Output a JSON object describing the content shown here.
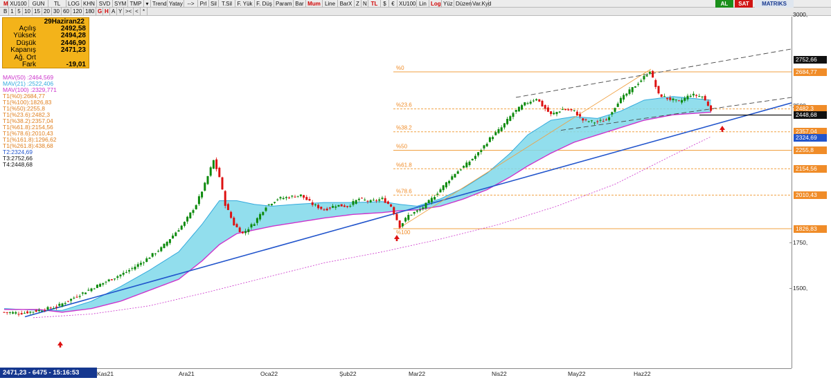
{
  "toolbar": {
    "row1": [
      "M",
      "XU100",
      "GUN",
      "TL",
      "LOG",
      "KHN",
      "SVD",
      "SYM",
      "TMP",
      "▾",
      "Trend",
      "Yatay",
      "-->",
      "Prl",
      "Sil",
      "T.Sil",
      "F. Yük",
      "F. Düş",
      "Param",
      "Bar",
      "Mum",
      "Line",
      "BarX",
      "Z",
      "N",
      "TL",
      "$",
      "€",
      "XU100",
      "Lin",
      "Log",
      "Yüz",
      "Düzen",
      "Var.Kyd"
    ],
    "row2": [
      "B",
      "1",
      "5",
      "10",
      "15",
      "20",
      "30",
      "60",
      "120",
      "180",
      "G",
      "H",
      "A",
      "Y",
      "><",
      "<",
      "*"
    ],
    "brand_buttons": [
      "AL",
      "SAT"
    ],
    "brand": "MATRIKS"
  },
  "ohlc": {
    "title": "29Haziran22",
    "rows": [
      {
        "label": "Açılış",
        "value": "2492,58"
      },
      {
        "label": "Yüksek",
        "value": "2494,28"
      },
      {
        "label": "Düşük",
        "value": "2446,90"
      },
      {
        "label": "Kapanış",
        "value": "2471,23"
      },
      {
        "label": "Ağ. Ort",
        "value": ""
      },
      {
        "label": "Fark",
        "value": "-19,01"
      }
    ]
  },
  "indicators": [
    {
      "text": "MAV(50)       :2464,569",
      "color": "#cc33cc"
    },
    {
      "text": "MAV(21)       :2522,406",
      "color": "#33aadd"
    },
    {
      "text": "MAV(100)     :2329,771",
      "color": "#cc33cc"
    },
    {
      "text": "T1(%0):2684,77",
      "color": "#e08020"
    },
    {
      "text": "T1(%100):1826,83",
      "color": "#e08020"
    },
    {
      "text": "T1(%50):2255,8",
      "color": "#e08020"
    },
    {
      "text": "T1(%23.6):2482,3",
      "color": "#e08020"
    },
    {
      "text": "T1(%38.2):2357,04",
      "color": "#e08020"
    },
    {
      "text": "T1(%61.8):2154,56",
      "color": "#e08020"
    },
    {
      "text": "T1(%78.6):2010,43",
      "color": "#e08020"
    },
    {
      "text": "T1(%161.8):1296,62",
      "color": "#e08020"
    },
    {
      "text": "T1(%261.8):438,68",
      "color": "#e08020"
    },
    {
      "text": "T2:2324,69",
      "color": "#2255cc"
    },
    {
      "text": "T3:2752,66",
      "color": "#111111"
    },
    {
      "text": "T4:2448,68",
      "color": "#111111"
    }
  ],
  "chart_data": {
    "type": "candlestick",
    "symbol": "XU100",
    "x_labels": [
      "Kas21",
      "Ara21",
      "Oca22",
      "Şub22",
      "Mar22",
      "Nis22",
      "May22",
      "Haz22"
    ],
    "y_ticks": [
      "3000,",
      "2500,",
      "1750,",
      "1500,"
    ],
    "y_range": [
      1300,
      3050
    ],
    "price_tags": [
      {
        "text": "2752,66",
        "bg": "#111111",
        "fg": "#ffffff"
      },
      {
        "text": "2684,77",
        "bg": "#f08c28",
        "fg": "#ffffff"
      },
      {
        "text": "2482,3",
        "bg": "#f08c28",
        "fg": "#ffffff"
      },
      {
        "text": "2448,68",
        "bg": "#111111",
        "fg": "#ffffff"
      },
      {
        "text": "2357,04",
        "bg": "#f08c28",
        "fg": "#ffffff"
      },
      {
        "text": "2324,69",
        "bg": "#2255cc",
        "fg": "#ffffff"
      },
      {
        "text": "2255,8",
        "bg": "#f08c28",
        "fg": "#ffffff"
      },
      {
        "text": "2154,56",
        "bg": "#f08c28",
        "fg": "#ffffff"
      },
      {
        "text": "2010,43",
        "bg": "#f08c28",
        "fg": "#ffffff"
      },
      {
        "text": "1826,83",
        "bg": "#f08c28",
        "fg": "#ffffff"
      }
    ],
    "fib_levels": [
      {
        "label": "%0",
        "value": 2684.77
      },
      {
        "label": "%23.6",
        "value": 2482.3
      },
      {
        "label": "%38.2",
        "value": 2357.04
      },
      {
        "label": "%50",
        "value": 2255.8
      },
      {
        "label": "%61.8",
        "value": 2154.56
      },
      {
        "label": "%78.6",
        "value": 2010.43
      },
      {
        "label": "%100",
        "value": 1826.83
      }
    ],
    "close_anchors": [
      [
        0,
        1370
      ],
      [
        6,
        1365
      ],
      [
        12,
        1380
      ],
      [
        18,
        1400
      ],
      [
        24,
        1450
      ],
      [
        30,
        1500
      ],
      [
        36,
        1545
      ],
      [
        42,
        1590
      ],
      [
        48,
        1650
      ],
      [
        54,
        1720
      ],
      [
        58,
        1790
      ],
      [
        62,
        1860
      ],
      [
        66,
        1960
      ],
      [
        69,
        2070
      ],
      [
        72,
        2200
      ],
      [
        74,
        2110
      ],
      [
        76,
        1960
      ],
      [
        79,
        1850
      ],
      [
        82,
        1800
      ],
      [
        86,
        1860
      ],
      [
        90,
        1950
      ],
      [
        94,
        1990
      ],
      [
        98,
        2000
      ],
      [
        102,
        2010
      ],
      [
        106,
        1960
      ],
      [
        110,
        1930
      ],
      [
        114,
        1955
      ],
      [
        118,
        1950
      ],
      [
        122,
        1990
      ],
      [
        126,
        1975
      ],
      [
        130,
        1990
      ],
      [
        133,
        1950
      ],
      [
        136,
        1840
      ],
      [
        139,
        1900
      ],
      [
        143,
        1930
      ],
      [
        147,
        1990
      ],
      [
        151,
        2060
      ],
      [
        155,
        2130
      ],
      [
        159,
        2180
      ],
      [
        163,
        2240
      ],
      [
        167,
        2320
      ],
      [
        171,
        2380
      ],
      [
        175,
        2460
      ],
      [
        179,
        2510
      ],
      [
        183,
        2540
      ],
      [
        185,
        2500
      ],
      [
        188,
        2450
      ],
      [
        192,
        2480
      ],
      [
        196,
        2470
      ],
      [
        199,
        2420
      ],
      [
        203,
        2410
      ],
      [
        207,
        2420
      ],
      [
        211,
        2520
      ],
      [
        215,
        2580
      ],
      [
        219,
        2640
      ],
      [
        222,
        2690
      ],
      [
        225,
        2560
      ],
      [
        228,
        2540
      ],
      [
        232,
        2520
      ],
      [
        236,
        2560
      ],
      [
        240,
        2550
      ],
      [
        243,
        2480
      ]
    ],
    "band_mav21_anchors": [
      [
        0,
        1390
      ],
      [
        12,
        1380
      ],
      [
        20,
        1380
      ],
      [
        30,
        1430
      ],
      [
        40,
        1510
      ],
      [
        50,
        1600
      ],
      [
        60,
        1700
      ],
      [
        68,
        1850
      ],
      [
        74,
        1980
      ],
      [
        80,
        1980
      ],
      [
        86,
        1960
      ],
      [
        92,
        1950
      ],
      [
        100,
        1960
      ],
      [
        110,
        1970
      ],
      [
        120,
        1970
      ],
      [
        130,
        1975
      ],
      [
        136,
        1960
      ],
      [
        142,
        1950
      ],
      [
        150,
        1990
      ],
      [
        158,
        2050
      ],
      [
        166,
        2130
      ],
      [
        174,
        2240
      ],
      [
        180,
        2340
      ],
      [
        188,
        2420
      ],
      [
        196,
        2440
      ],
      [
        204,
        2430
      ],
      [
        212,
        2470
      ],
      [
        220,
        2530
      ],
      [
        230,
        2550
      ],
      [
        243,
        2530
      ]
    ],
    "band_mav50_anchors": [
      [
        0,
        1385
      ],
      [
        12,
        1385
      ],
      [
        20,
        1370
      ],
      [
        30,
        1390
      ],
      [
        40,
        1430
      ],
      [
        50,
        1490
      ],
      [
        60,
        1550
      ],
      [
        68,
        1650
      ],
      [
        74,
        1740
      ],
      [
        80,
        1800
      ],
      [
        86,
        1820
      ],
      [
        92,
        1840
      ],
      [
        100,
        1860
      ],
      [
        110,
        1885
      ],
      [
        120,
        1905
      ],
      [
        130,
        1915
      ],
      [
        136,
        1925
      ],
      [
        142,
        1930
      ],
      [
        150,
        1950
      ],
      [
        158,
        1990
      ],
      [
        166,
        2040
      ],
      [
        174,
        2110
      ],
      [
        180,
        2170
      ],
      [
        188,
        2240
      ],
      [
        196,
        2300
      ],
      [
        204,
        2340
      ],
      [
        212,
        2380
      ],
      [
        220,
        2420
      ],
      [
        230,
        2450
      ],
      [
        243,
        2464
      ]
    ],
    "mav100_anchors": [
      [
        10,
        1340
      ],
      [
        30,
        1360
      ],
      [
        50,
        1405
      ],
      [
        70,
        1480
      ],
      [
        90,
        1560
      ],
      [
        110,
        1640
      ],
      [
        130,
        1700
      ],
      [
        150,
        1770
      ],
      [
        170,
        1850
      ],
      [
        190,
        1950
      ],
      [
        210,
        2070
      ],
      [
        230,
        2230
      ],
      [
        243,
        2330
      ]
    ],
    "candle_count": 244,
    "up_color": "#0c8a0c",
    "down_color": "#dd1111",
    "band_fill": "#7fd8ea",
    "mav50_color": "#cc33cc",
    "mav21_color": "#33aadd",
    "trend_color": "#2255cc"
  },
  "status": {
    "text": "2471,23 - 6475 - 15:16:53"
  }
}
